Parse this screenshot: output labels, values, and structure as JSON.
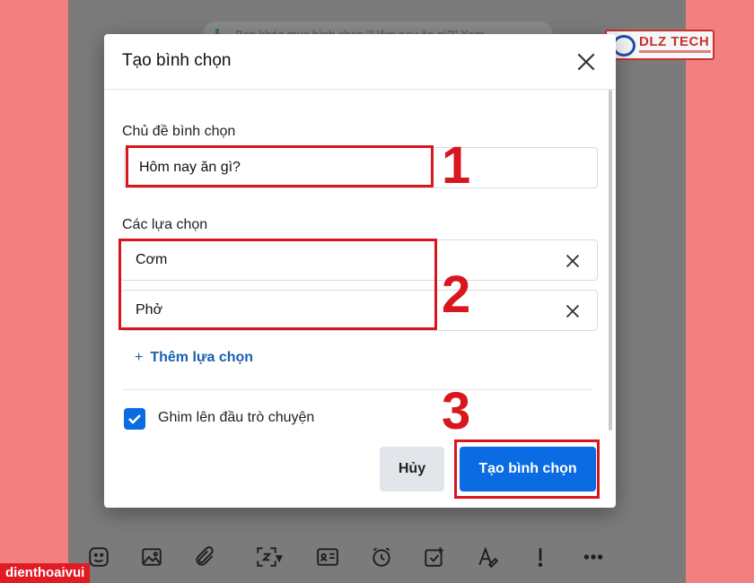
{
  "chat": {
    "banner_text": "Bạn khác mục bình chọn \"Hôm nay ăn gì?\" Xem"
  },
  "dialog": {
    "title": "Tạo bình chọn",
    "topic_label": "Chủ đề bình chọn",
    "topic_value": "Hôm nay ăn gì?",
    "options_label": "Các lựa chọn",
    "options": [
      {
        "value": "Cơm"
      },
      {
        "value": "Phở"
      }
    ],
    "add_option_label": "Thêm lựa chọn",
    "add_option_symbol": "+",
    "pin_label": "Ghim lên đầu trò chuyện",
    "pin_checked": true,
    "cancel_label": "Hủy",
    "create_label": "Tạo bình chọn"
  },
  "annotations": {
    "step1": "1",
    "step2": "2",
    "step3": "3"
  },
  "branding": {
    "watermark": "dienthoaivui",
    "logo_text": "DLZ TECH"
  },
  "colors": {
    "page_bg": "#f28080",
    "overlay": "#7b7b7b",
    "primary": "#0b6be3",
    "link": "#1b5fb0",
    "annotation": "#d9151e"
  },
  "toolbar_icons": [
    "sticker-icon",
    "image-icon",
    "attachment-icon",
    "screenshot-icon",
    "contact-card-icon",
    "reminder-icon",
    "task-icon",
    "text-format-icon",
    "urgent-icon",
    "more-icon"
  ]
}
